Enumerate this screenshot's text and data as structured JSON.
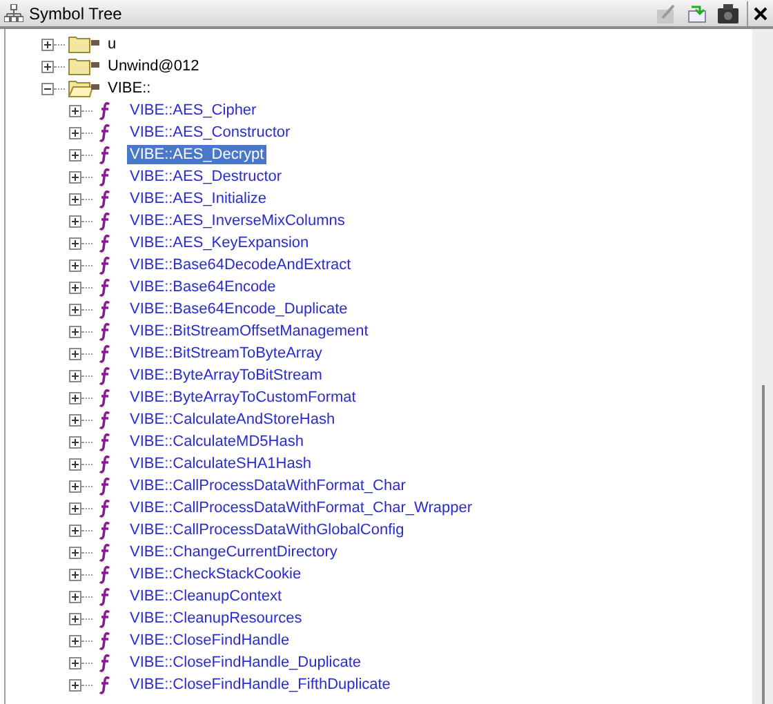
{
  "panel": {
    "title": "Symbol Tree"
  },
  "tree": [
    {
      "label": "u",
      "kind": "folder",
      "expanded": false
    },
    {
      "label": "Unwind@012",
      "kind": "folder",
      "expanded": false
    },
    {
      "label": "VIBE::",
      "kind": "folder",
      "expanded": true,
      "children": [
        {
          "label": "VIBE::AES_Cipher",
          "kind": "function",
          "selected": false
        },
        {
          "label": "VIBE::AES_Constructor",
          "kind": "function",
          "selected": false
        },
        {
          "label": "VIBE::AES_Decrypt",
          "kind": "function",
          "selected": true
        },
        {
          "label": "VIBE::AES_Destructor",
          "kind": "function",
          "selected": false
        },
        {
          "label": "VIBE::AES_Initialize",
          "kind": "function",
          "selected": false
        },
        {
          "label": "VIBE::AES_InverseMixColumns",
          "kind": "function",
          "selected": false
        },
        {
          "label": "VIBE::AES_KeyExpansion",
          "kind": "function",
          "selected": false
        },
        {
          "label": "VIBE::Base64DecodeAndExtract",
          "kind": "function",
          "selected": false
        },
        {
          "label": "VIBE::Base64Encode",
          "kind": "function",
          "selected": false
        },
        {
          "label": "VIBE::Base64Encode_Duplicate",
          "kind": "function",
          "selected": false
        },
        {
          "label": "VIBE::BitStreamOffsetManagement",
          "kind": "function",
          "selected": false
        },
        {
          "label": "VIBE::BitStreamToByteArray",
          "kind": "function",
          "selected": false
        },
        {
          "label": "VIBE::ByteArrayToBitStream",
          "kind": "function",
          "selected": false
        },
        {
          "label": "VIBE::ByteArrayToCustomFormat",
          "kind": "function",
          "selected": false
        },
        {
          "label": "VIBE::CalculateAndStoreHash",
          "kind": "function",
          "selected": false
        },
        {
          "label": "VIBE::CalculateMD5Hash",
          "kind": "function",
          "selected": false
        },
        {
          "label": "VIBE::CalculateSHA1Hash",
          "kind": "function",
          "selected": false
        },
        {
          "label": "VIBE::CallProcessDataWithFormat_Char",
          "kind": "function",
          "selected": false
        },
        {
          "label": "VIBE::CallProcessDataWithFormat_Char_Wrapper",
          "kind": "function",
          "selected": false
        },
        {
          "label": "VIBE::CallProcessDataWithGlobalConfig",
          "kind": "function",
          "selected": false
        },
        {
          "label": "VIBE::ChangeCurrentDirectory",
          "kind": "function",
          "selected": false
        },
        {
          "label": "VIBE::CheckStackCookie",
          "kind": "function",
          "selected": false
        },
        {
          "label": "VIBE::CleanupContext",
          "kind": "function",
          "selected": false
        },
        {
          "label": "VIBE::CleanupResources",
          "kind": "function",
          "selected": false
        },
        {
          "label": "VIBE::CloseFindHandle",
          "kind": "function",
          "selected": false
        },
        {
          "label": "VIBE::CloseFindHandle_Duplicate",
          "kind": "function",
          "selected": false
        },
        {
          "label": "VIBE::CloseFindHandle_FifthDuplicate",
          "kind": "function",
          "selected": false
        }
      ]
    }
  ]
}
